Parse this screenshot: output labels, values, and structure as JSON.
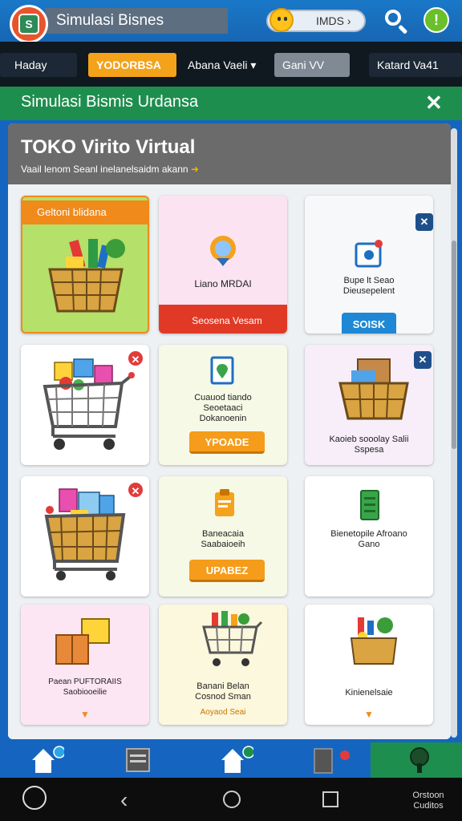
{
  "app": {
    "title": "Simulasi Bisnes",
    "status_text": "IMDS ›",
    "alert_symbol": "!"
  },
  "nav_tabs": [
    {
      "label": "Haday"
    },
    {
      "label": "YODORBSA"
    },
    {
      "label": "Abana Vaeli ▾"
    },
    {
      "label": "Gani VV"
    },
    {
      "label": "Katard Va41"
    }
  ],
  "section": {
    "title": "Simulasi Bismis Urdansa",
    "close_symbol": "✕"
  },
  "panel": {
    "heading": "TOKO Virito Virtual",
    "subheading": "Vaail lenom Seanl inelanelsaidm akann",
    "subheading_arrow": "➜"
  },
  "cards": [
    {
      "tag": "Geltoni blidana"
    },
    {
      "label": "Liano MRDAI",
      "button": "Seosena Vesam"
    },
    {
      "label": "Bupe lt Seao Dieusepelent",
      "button": "SOISK"
    },
    {
      "label": ""
    },
    {
      "label": "Cuauod tiando Seoetaaci Dokanoenin",
      "button": "YPOADE"
    },
    {
      "label": "Kaoieb sooolay Salii Sspesa"
    },
    {
      "label": ""
    },
    {
      "label": "Baneacaia Saabaioeih",
      "button": "UPABEZ"
    },
    {
      "label": "Bienetopile Afroano Gano"
    },
    {
      "label": "Paean PUFTORAIIS Saobiooeilie"
    },
    {
      "label": "Banani Belan Cosnod Sman",
      "sublabel": "Aoyaod Seai"
    },
    {
      "label": "Kinienelsaie"
    }
  ],
  "system_nav": {
    "right_label": "Orstoon Cuditos"
  },
  "colors": {
    "top_bar": "#1766b3",
    "accent_orange": "#f59c1a",
    "accent_green": "#1e8e4e",
    "danger_red": "#e03a26",
    "button_blue": "#1e88d4"
  }
}
